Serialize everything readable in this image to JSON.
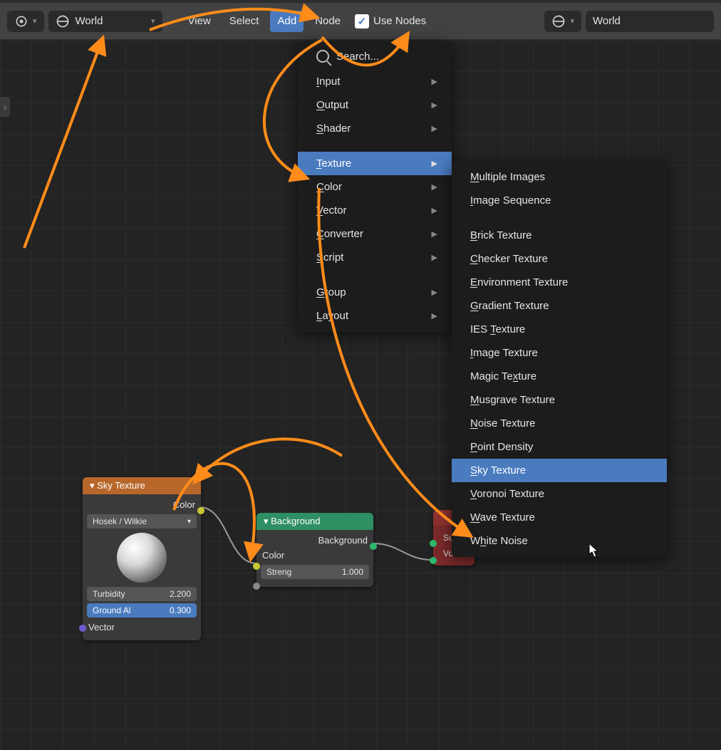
{
  "header": {
    "shading_label": "World",
    "view": "View",
    "select": "Select",
    "add": "Add",
    "node": "Node",
    "use_nodes": "Use Nodes",
    "datablock": "World"
  },
  "add_menu": {
    "search": "Search...",
    "items": [
      {
        "label": "Input",
        "u": "I",
        "sub": true
      },
      {
        "label": "Output",
        "u": "O",
        "sub": true
      },
      {
        "label": "Shader",
        "u": "S",
        "sub": true
      },
      {
        "label": "Texture",
        "u": "T",
        "sub": true,
        "hl": true
      },
      {
        "label": "Color",
        "u": "C",
        "sub": true
      },
      {
        "label": "Vector",
        "u": "V",
        "sub": true
      },
      {
        "label": "Converter",
        "u": "C",
        "sub": true
      },
      {
        "label": "Script",
        "u": "S",
        "sub": true
      },
      {
        "label": "Group",
        "u": "G",
        "sub": true
      },
      {
        "label": "Layout",
        "u": "L",
        "sub": true
      }
    ]
  },
  "tex_menu": {
    "block1": [
      {
        "label": "Multiple Images",
        "u": "M"
      },
      {
        "label": "Image Sequence",
        "u": "I"
      }
    ],
    "block2": [
      {
        "label": "Brick Texture",
        "u": "B"
      },
      {
        "label": "Checker Texture",
        "u": "C"
      },
      {
        "label": "Environment Texture",
        "u": "E"
      },
      {
        "label": "Gradient Texture",
        "u": "G"
      },
      {
        "label": "IES Texture",
        "u": "T"
      },
      {
        "label": "Image Texture",
        "u": "I"
      },
      {
        "label": "Magic Texture",
        "u": "x"
      },
      {
        "label": "Musgrave Texture",
        "u": "M"
      },
      {
        "label": "Noise Texture",
        "u": "N"
      },
      {
        "label": "Point Density",
        "u": "P"
      },
      {
        "label": "Sky Texture",
        "u": "S",
        "hl": true
      },
      {
        "label": "Voronoi Texture",
        "u": "V"
      },
      {
        "label": "Wave Texture",
        "u": "W"
      },
      {
        "label": "White Noise",
        "u": "h"
      }
    ]
  },
  "sky_node": {
    "title": "Sky Texture",
    "out_color": "Color",
    "model": "Hosek / Wilkie",
    "turbidity_label": "Turbidity",
    "turbidity_val": "2.200",
    "ground_label": "Ground Al",
    "ground_val": "0.300",
    "in_vector": "Vector"
  },
  "bg_node": {
    "title": "Background",
    "out_background": "Background",
    "in_color": "Color",
    "strength_label": "Streng",
    "strength_val": "1.000"
  },
  "out_node": {
    "surface": "Surface",
    "volume": "Volume"
  }
}
